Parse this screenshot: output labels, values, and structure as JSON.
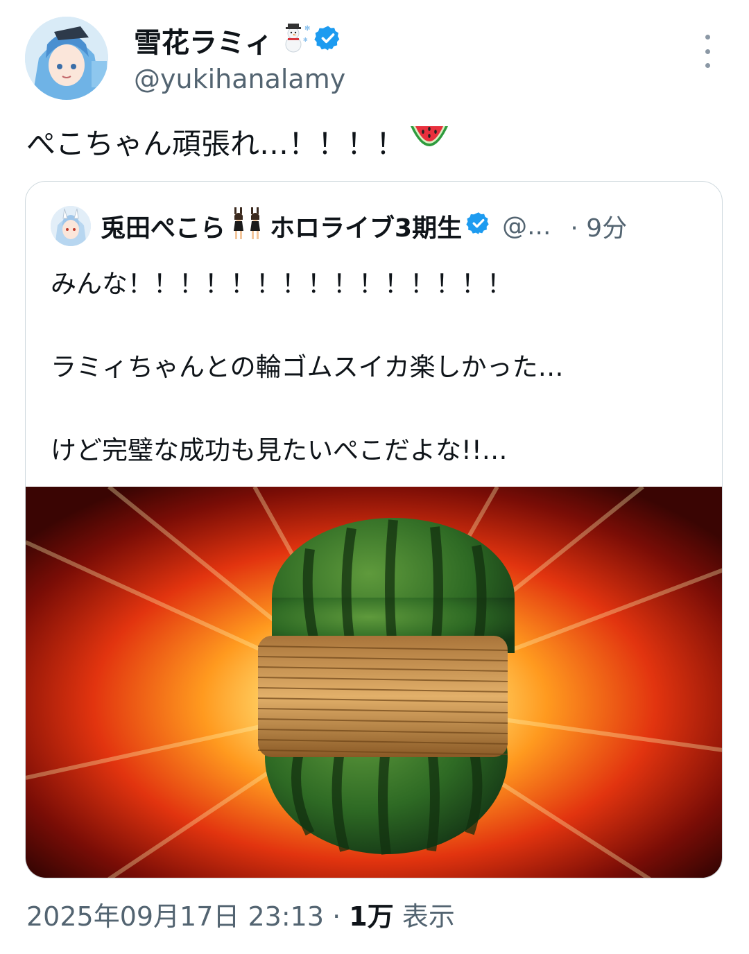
{
  "tweet": {
    "display_name": "雪花ラミィ",
    "name_emoji": "snowman-icon",
    "verified": true,
    "handle": "@yukihanalamy",
    "text": "ぺこちゃん頑張れ…！！！！",
    "text_emoji": "watermelon-icon",
    "timestamp": "2025年09月17日 23:13",
    "separator": "·",
    "views_count": "1万",
    "views_label": "表示"
  },
  "quoted": {
    "display_name": "兎田ぺこら",
    "name_suffix": "ホロライブ3期生",
    "name_emoji": "bunny-girls-icon",
    "verified": true,
    "handle": "@...",
    "time": "· 9分",
    "lines": [
      "みんな！！！！！！！！！！！！！！！",
      "ラミィちゃんとの輪ゴムスイカ楽しかった…",
      "けど完璧な成功も見たいぺこだよな!!…"
    ],
    "image_alt": "watermelon-with-rubber-bands"
  },
  "colors": {
    "verified": "#1d9bf0",
    "secondary_text": "#536471",
    "border": "#cfd9de"
  }
}
